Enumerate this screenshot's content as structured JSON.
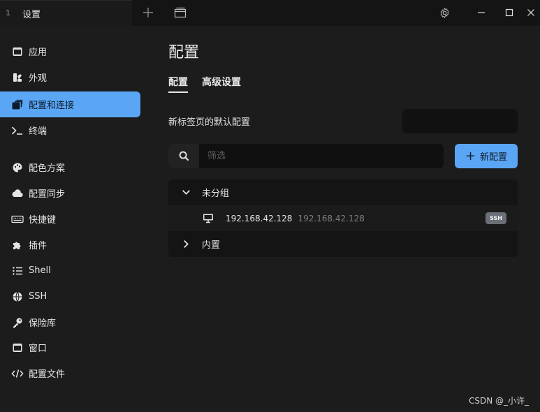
{
  "window": {
    "tab_index": "1",
    "tab_title": "设置"
  },
  "sidebar": {
    "items": [
      {
        "label": "应用",
        "icon": "window-icon"
      },
      {
        "label": "外观",
        "icon": "palette-brush-icon"
      },
      {
        "label": "配置和连接",
        "icon": "profiles-icon",
        "active": true
      },
      {
        "label": "终端",
        "icon": "terminal-icon"
      },
      {
        "label": "配色方案",
        "icon": "palette-icon"
      },
      {
        "label": "配置同步",
        "icon": "cloud-icon"
      },
      {
        "label": "快捷键",
        "icon": "keyboard-icon"
      },
      {
        "label": "插件",
        "icon": "puzzle-icon"
      },
      {
        "label": "Shell",
        "icon": "list-icon"
      },
      {
        "label": "SSH",
        "icon": "globe-icon"
      },
      {
        "label": "保险库",
        "icon": "key-icon"
      },
      {
        "label": "窗口",
        "icon": "window-icon"
      },
      {
        "label": "配置文件",
        "icon": "code-icon"
      }
    ]
  },
  "main": {
    "title": "配置",
    "tabs": [
      {
        "label": "配置",
        "active": true
      },
      {
        "label": "高级设置"
      }
    ],
    "default_profile_label": "新标签页的默认配置",
    "default_profile_value": "",
    "search": {
      "placeholder": "筛选",
      "value": ""
    },
    "new_profile_label": "新配置",
    "groups": [
      {
        "name": "未分组",
        "expanded": true,
        "profiles": [
          {
            "name": "192.168.42.128",
            "host": "192.168.42.128",
            "badge": "SSH"
          }
        ]
      },
      {
        "name": "内置",
        "expanded": false
      }
    ]
  },
  "watermark": "CSDN @_小许_",
  "colors": {
    "accent": "#5aa6f4",
    "background": "#1c1c1c",
    "titlebar": "#141414"
  }
}
